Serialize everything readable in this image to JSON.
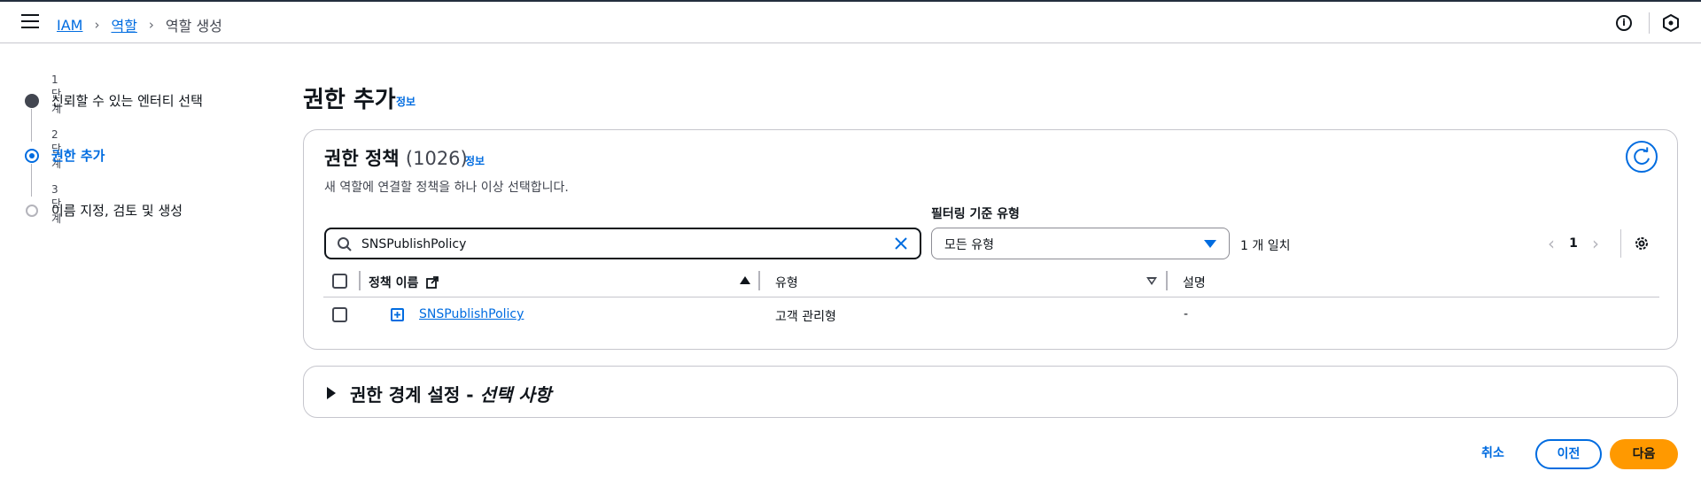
{
  "breadcrumbs": {
    "items": [
      "IAM",
      "역할"
    ],
    "current": "역할 생성"
  },
  "header": {
    "info_icon_glyph": "i"
  },
  "steps": [
    {
      "num": "1단계",
      "name": "신뢰할 수 있는 엔터티 선택",
      "state": "done"
    },
    {
      "num": "2단계",
      "name": "권한 추가",
      "state": "active"
    },
    {
      "num": "3단계",
      "name": "이름 지정, 검토 및 생성",
      "state": "todo"
    }
  ],
  "page": {
    "title": "권한 추가",
    "info_label": "정보"
  },
  "policies": {
    "title": "권한 정책",
    "count": "(1026)",
    "info_label": "정보",
    "description": "새 역할에 연결할 정책을 하나 이상 선택합니다.",
    "search_value": "SNSPublishPolicy",
    "filter_label": "필터링 기준 유형",
    "filter_value": "모든 유형",
    "match_count": "1 개 일치",
    "pagination": {
      "prev": "‹",
      "page": "1",
      "next": "›"
    },
    "columns": [
      "정책 이름",
      "유형",
      "설명"
    ],
    "rows": [
      {
        "name": "SNSPublishPolicy",
        "type": "고객 관리형",
        "description": "-",
        "selected": false
      }
    ]
  },
  "boundary": {
    "title_prefix": "권한 경계 설정 - ",
    "title_optional": "선택 사항"
  },
  "footer": {
    "cancel": "취소",
    "previous": "이전",
    "next": "다음"
  },
  "colors": {
    "link": "#006ce0",
    "primary_button": "#ff9900",
    "text": "#0f141a",
    "border": "#c6c6cd"
  }
}
